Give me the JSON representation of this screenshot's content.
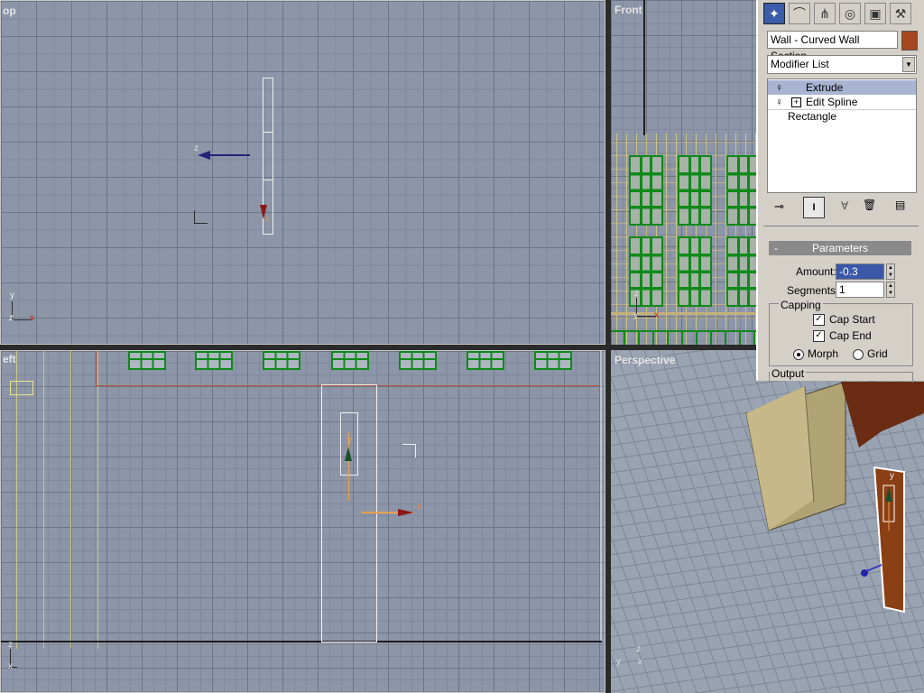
{
  "viewports": {
    "top": {
      "label": "op"
    },
    "front": {
      "label": "Front"
    },
    "left": {
      "label": "eft"
    },
    "perspective": {
      "label": "Perspective"
    }
  },
  "axes": {
    "x": "x",
    "y": "y",
    "z": "z"
  },
  "panel": {
    "tabs": [
      {
        "icon": "create-wand-icon"
      },
      {
        "icon": "modify-curve-icon"
      },
      {
        "icon": "hierarchy-icon"
      },
      {
        "icon": "motion-icon"
      },
      {
        "icon": "display-icon"
      },
      {
        "icon": "utilities-hammer-icon"
      }
    ],
    "object_name": "Wall - Curved Wall Section",
    "object_color": "#a6481f",
    "modifier_list": "Modifier List",
    "stack": [
      {
        "label": "Extrude",
        "selected": true
      },
      {
        "label": "Edit Spline",
        "selected": false
      },
      {
        "label": "Rectangle",
        "selected": false
      }
    ],
    "parameters": {
      "header": "Parameters",
      "collapse": "-",
      "amount_label": "Amount:",
      "amount_value": "-0.3",
      "segments_label": "Segments:",
      "segments_value": "1",
      "capping_label": "Capping",
      "cap_start": "Cap Start",
      "cap_end": "Cap End",
      "morph": "Morph",
      "grid": "Grid",
      "output_label": "Output"
    }
  }
}
